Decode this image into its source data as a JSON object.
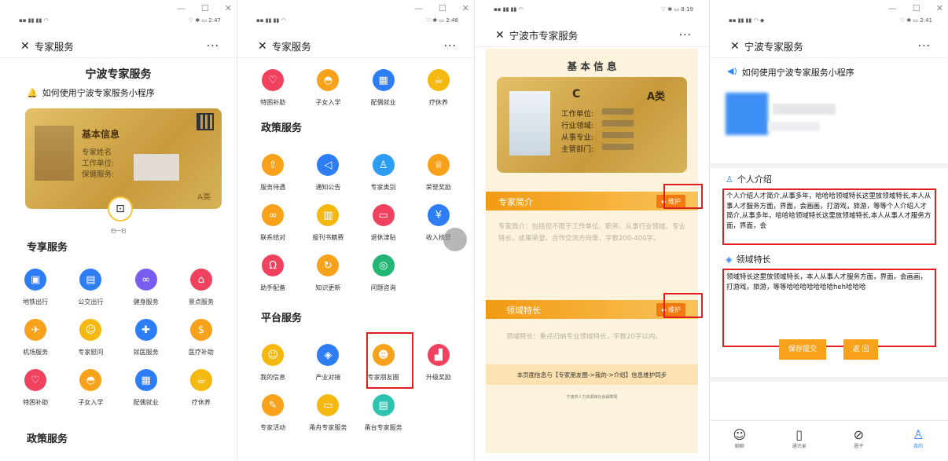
{
  "colors": {
    "red": "#f0425e",
    "orange": "#f8a21b",
    "blue": "#2d7df4",
    "purple": "#7a5cf0",
    "yellow": "#f5b80f",
    "gold": "#d7ac4e",
    "accent_blue": "#2f86f6",
    "highlight": "#e02020"
  },
  "p1": {
    "title": "专家服务",
    "app_name": "宁波专家服务",
    "how_to": "如何使用宁波专家服务小程序",
    "card_title": "基本信息",
    "card_lines": [
      "专家姓名",
      "工作单位:",
      "保健服务:"
    ],
    "grade": "A类",
    "scan": "扫一扫",
    "section1": "专享服务",
    "items": [
      {
        "label": "地铁出行",
        "icon": "subway-icon",
        "color": "#2d7df4"
      },
      {
        "label": "公交出行",
        "icon": "bus-icon",
        "color": "#2d7df4"
      },
      {
        "label": "健身服务",
        "icon": "bike-icon",
        "color": "#7a5cf0"
      },
      {
        "label": "景点服务",
        "icon": "temple-icon",
        "color": "#f0425e"
      },
      {
        "label": "机场服务",
        "icon": "plane-icon",
        "color": "#f8a21b"
      },
      {
        "label": "专家慰问",
        "icon": "people-icon",
        "color": "#f5b80f"
      },
      {
        "label": "就医服务",
        "icon": "hospital-icon",
        "color": "#2d7df4"
      },
      {
        "label": "医疗补助",
        "icon": "money-bag-icon",
        "color": "#f8a21b"
      },
      {
        "label": "特困补助",
        "icon": "heart-icon",
        "color": "#f0425e"
      },
      {
        "label": "子女入学",
        "icon": "graduation-icon",
        "color": "#f8a21b"
      },
      {
        "label": "配偶就业",
        "icon": "id-card-icon",
        "color": "#2d7df4"
      },
      {
        "label": "疗休养",
        "icon": "cup-icon",
        "color": "#f5b80f"
      }
    ],
    "section2": "政策服务",
    "time": "2:47"
  },
  "p2": {
    "title": "专家服务",
    "top_items": [
      {
        "label": "特困补助",
        "icon": "heart-icon",
        "color": "#f0425e"
      },
      {
        "label": "子女入学",
        "icon": "graduation-icon",
        "color": "#f8a21b"
      },
      {
        "label": "配偶就业",
        "icon": "id-card-icon",
        "color": "#2d7df4"
      },
      {
        "label": "疗休养",
        "icon": "cup-icon",
        "color": "#f5b80f"
      }
    ],
    "section1": "政策服务",
    "policy_items": [
      {
        "label": "服务待遇",
        "icon": "signpost-icon",
        "color": "#f8a21b"
      },
      {
        "label": "通知公告",
        "icon": "speaker-icon",
        "color": "#2d7df4"
      },
      {
        "label": "专家类别",
        "icon": "user-icon",
        "color": "#2d9df4"
      },
      {
        "label": "荣誉奖励",
        "icon": "trophy-icon",
        "color": "#f8a21b"
      },
      {
        "label": "联系结对",
        "icon": "link-icon",
        "color": "#f8a21b"
      },
      {
        "label": "报刊书籍费",
        "icon": "book-icon",
        "color": "#f5b80f"
      },
      {
        "label": "退休津贴",
        "icon": "wallet-icon",
        "color": "#f0425e"
      },
      {
        "label": "收入核算",
        "icon": "yen-icon",
        "color": "#2d7df4"
      },
      {
        "label": "助手配备",
        "icon": "headset-icon",
        "color": "#f0425e"
      },
      {
        "label": "知识更新",
        "icon": "refresh-icon",
        "color": "#f8a21b"
      },
      {
        "label": "问题咨询",
        "icon": "chat-icon",
        "color": "#22b573"
      }
    ],
    "section2": "平台服务",
    "platform_items": [
      {
        "label": "我的信息",
        "icon": "person-icon",
        "color": "#f5b80f"
      },
      {
        "label": "产业对接",
        "icon": "handshake-icon",
        "color": "#2d7df4"
      },
      {
        "label": "专家朋友圈",
        "icon": "friends-icon",
        "color": "#f8a21b"
      },
      {
        "label": "升级奖励",
        "icon": "stairs-icon",
        "color": "#f0425e"
      },
      {
        "label": "专家活动",
        "icon": "edit-icon",
        "color": "#f8a21b"
      },
      {
        "label": "甬舟专家服务",
        "icon": "screen-icon",
        "color": "#f5b80f"
      },
      {
        "label": "甬台专家服务",
        "icon": "doc-icon",
        "color": "#2dc3b0"
      }
    ],
    "time": "2:48"
  },
  "p3": {
    "title": "宁波市专家服务",
    "header": "基 本 信 息",
    "name": "C",
    "grade": "A类",
    "fields": [
      "工作单位:",
      "行业领域:",
      "从事专业:",
      "主管部门:"
    ],
    "intro_title": "专家简介",
    "maintain": "◆ 维护",
    "intro_placeholder": "专家简介：包括但不限于工作单位、职务、从事行业领域、专业特长、成果荣誉、合作交流方向等，字数200-400字。",
    "field_title": "领域特长",
    "field_placeholder": "领域特长：重点归纳专业领域特长，字数20字以内。",
    "sync_note": "本页面信息与【专家朋友圈->我的->介绍】信息维护同步",
    "footer": "宁波市人力资源和社会保障局",
    "time": "8:19"
  },
  "p4": {
    "title": "宁波专家服务",
    "how_to": "如何使用宁波专家服务小程序",
    "intro_title": "个人介绍",
    "intro_text": "个人介绍人才简介,从事多年，哈哈哈领域特长这里放领域特长,本人从事人才服务方面，界面，会画画，打游戏，旅游，等等个人介绍人才简介,从事多年，哈哈哈领域特长这里放领域特长,本人从事人才服务方面，界面，会",
    "field_title": "领域特长",
    "field_text": "领域特长这里放领域特长，本人从事人才服务方面，界面，会画画，打游戏，旅游，等等哈哈哈哈哈哈哈heh哈哈哈",
    "save": "保存提交",
    "back": "返 回",
    "tabs": [
      {
        "label": "聊聊",
        "icon": "chat-bubble-icon"
      },
      {
        "label": "通讯录",
        "icon": "contacts-icon"
      },
      {
        "label": "圈子",
        "icon": "compass-icon"
      },
      {
        "label": "我的",
        "icon": "me-icon"
      }
    ],
    "time": "2:41"
  }
}
